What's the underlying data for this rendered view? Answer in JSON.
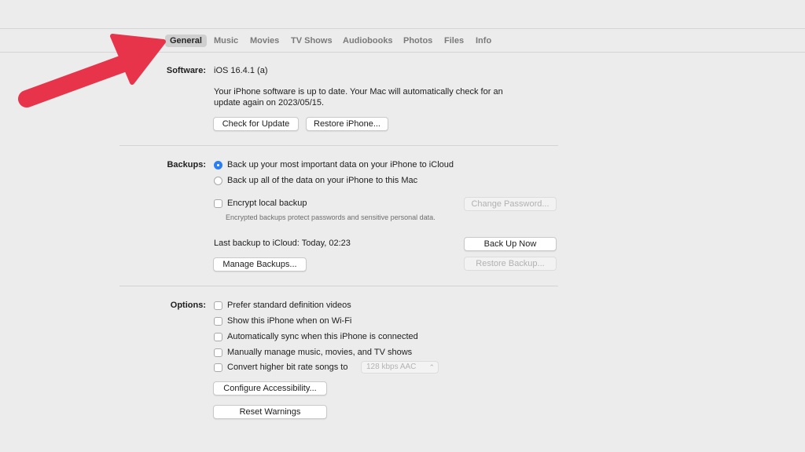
{
  "tabs": [
    "General",
    "Music",
    "Movies",
    "TV Shows",
    "Audiobooks",
    "Photos",
    "Files",
    "Info"
  ],
  "software": {
    "label": "Software:",
    "version": "iOS 16.4.1 (a)",
    "status_line1": "Your iPhone software is up to date. Your Mac will automatically check for an",
    "status_line2": "update again on 2023/05/15.",
    "check_button": "Check for Update",
    "restore_button": "Restore iPhone..."
  },
  "backups": {
    "label": "Backups:",
    "option_icloud": "Back up your most important data on your iPhone to iCloud",
    "option_mac": "Back up all of the data on your iPhone to this Mac",
    "encrypt_label": "Encrypt local backup",
    "encrypt_note": "Encrypted backups protect passwords and sensitive personal data.",
    "change_password_button": "Change Password...",
    "last_backup_label": "Last backup to iCloud:",
    "last_backup_value": "Today, 02:23",
    "back_up_now_button": "Back Up Now",
    "manage_button": "Manage Backups...",
    "restore_backup_button": "Restore Backup..."
  },
  "options": {
    "label": "Options:",
    "prefer_sd": "Prefer standard definition videos",
    "show_wifi": "Show this iPhone when on Wi-Fi",
    "auto_sync": "Automatically sync when this iPhone is connected",
    "manually_manage": "Manually manage music, movies, and TV shows",
    "convert_bitrate": "Convert higher bit rate songs to",
    "bitrate_value": "128 kbps AAC",
    "configure_button": "Configure Accessibility...",
    "reset_button": "Reset Warnings"
  },
  "colors": {
    "accent": "#2a7ef5",
    "arrow": "#e8344a"
  }
}
